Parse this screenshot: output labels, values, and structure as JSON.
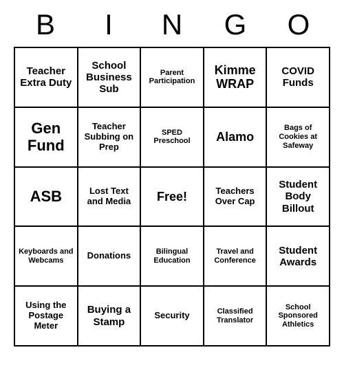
{
  "header": [
    "B",
    "I",
    "N",
    "G",
    "O"
  ],
  "grid": [
    [
      {
        "text": "Teacher Extra Duty",
        "size": "fs-m"
      },
      {
        "text": "School Business Sub",
        "size": "fs-m"
      },
      {
        "text": "Parent Participation",
        "size": "fs-xs"
      },
      {
        "text": "Kimme WRAP",
        "size": "fs-l"
      },
      {
        "text": "COVID Funds",
        "size": "fs-m"
      }
    ],
    [
      {
        "text": "Gen Fund",
        "size": "fs-xl"
      },
      {
        "text": "Teacher Subbing on Prep",
        "size": "fs-s"
      },
      {
        "text": "SPED Preschool",
        "size": "fs-xs"
      },
      {
        "text": "Alamo",
        "size": "fs-l"
      },
      {
        "text": "Bags of Cookies at Safeway",
        "size": "fs-xs"
      }
    ],
    [
      {
        "text": "ASB",
        "size": "fs-xl"
      },
      {
        "text": "Lost Text and Media",
        "size": "fs-s"
      },
      {
        "text": "Free!",
        "size": "fs-l"
      },
      {
        "text": "Teachers Over Cap",
        "size": "fs-s"
      },
      {
        "text": "Student Body Billout",
        "size": "fs-m"
      }
    ],
    [
      {
        "text": "Keyboards and Webcams",
        "size": "fs-xs"
      },
      {
        "text": "Donations",
        "size": "fs-s"
      },
      {
        "text": "Bilingual Education",
        "size": "fs-xs"
      },
      {
        "text": "Travel and Conference",
        "size": "fs-xs"
      },
      {
        "text": "Student Awards",
        "size": "fs-m"
      }
    ],
    [
      {
        "text": "Using the Postage Meter",
        "size": "fs-s"
      },
      {
        "text": "Buying a Stamp",
        "size": "fs-m"
      },
      {
        "text": "Security",
        "size": "fs-s"
      },
      {
        "text": "Classified Translator",
        "size": "fs-xs"
      },
      {
        "text": "School Sponsored Athletics",
        "size": "fs-xs"
      }
    ]
  ]
}
